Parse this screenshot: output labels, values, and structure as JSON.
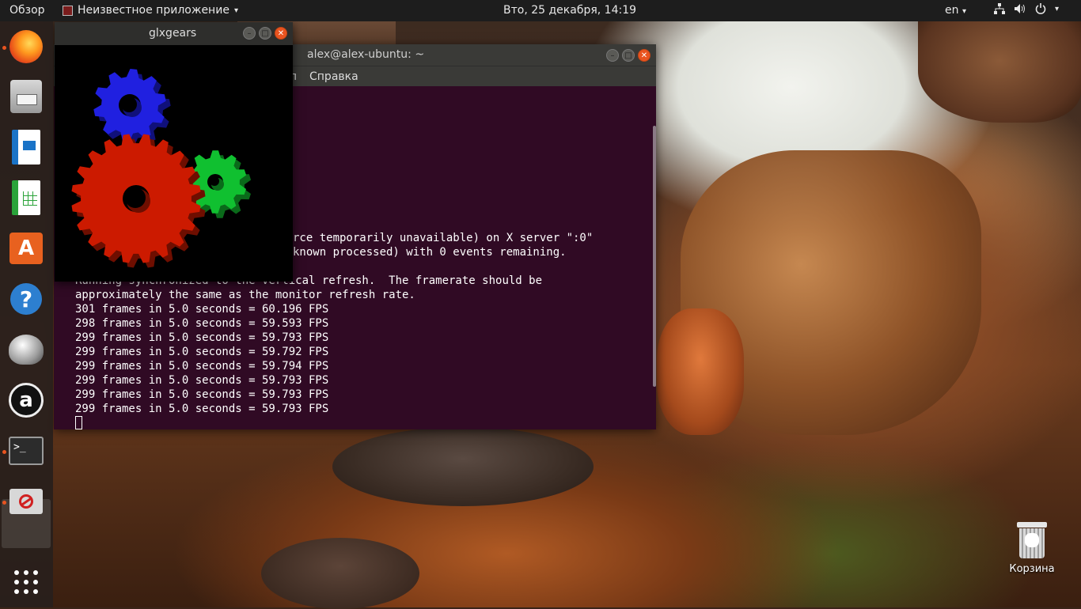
{
  "topbar": {
    "overview_label": "Обзор",
    "app_name": "Неизвестное приложение",
    "app_caret": "▾",
    "datetime": "Вто, 25 декабря, 14:19",
    "language": "en",
    "lang_caret": "▾",
    "network_icon": "network-icon",
    "volume_icon": "volume-icon",
    "power_icon": "power-icon",
    "sys_caret": "▾"
  },
  "dock": {
    "items": [
      {
        "name": "firefox",
        "running": true
      },
      {
        "name": "files",
        "running": false
      },
      {
        "name": "libreoffice-writer",
        "running": false
      },
      {
        "name": "libreoffice-calc",
        "running": false
      },
      {
        "name": "ubuntu-software",
        "running": false,
        "glyph": "A"
      },
      {
        "name": "help",
        "running": false,
        "glyph": "?"
      },
      {
        "name": "unknown-app",
        "running": false
      },
      {
        "name": "amazon",
        "running": false,
        "glyph": "a"
      },
      {
        "name": "terminal",
        "running": true,
        "glyph": ">_"
      },
      {
        "name": "unknown-application",
        "running": true,
        "active": true
      }
    ],
    "show_apps_icon": "app-grid-icon"
  },
  "terminal": {
    "title": "alex@alex-ubuntu: ~",
    "menu": [
      "л",
      "Справка"
    ],
    "lines_top": [
      "rce temporarily unavailable) on X server \":0\"",
      "known processed) with 0 events remaining."
    ],
    "lines_main": [
      "Running synchronized to the vertical refresh.  The framerate should be",
      "approximately the same as the monitor refresh rate.",
      "301 frames in 5.0 seconds = 60.196 FPS",
      "298 frames in 5.0 seconds = 59.593 FPS",
      "299 frames in 5.0 seconds = 59.793 FPS",
      "299 frames in 5.0 seconds = 59.792 FPS",
      "299 frames in 5.0 seconds = 59.794 FPS",
      "299 frames in 5.0 seconds = 59.793 FPS",
      "299 frames in 5.0 seconds = 59.793 FPS",
      "299 frames in 5.0 seconds = 59.793 FPS"
    ],
    "colors": {
      "background": "#300a24",
      "text": "#ffffff"
    }
  },
  "glxgears": {
    "title": "glxgears",
    "gear_colors": {
      "red": "#cc1a00",
      "green": "#10c030",
      "blue": "#2020e0"
    }
  },
  "desktop": {
    "trash_label": "Корзина"
  }
}
